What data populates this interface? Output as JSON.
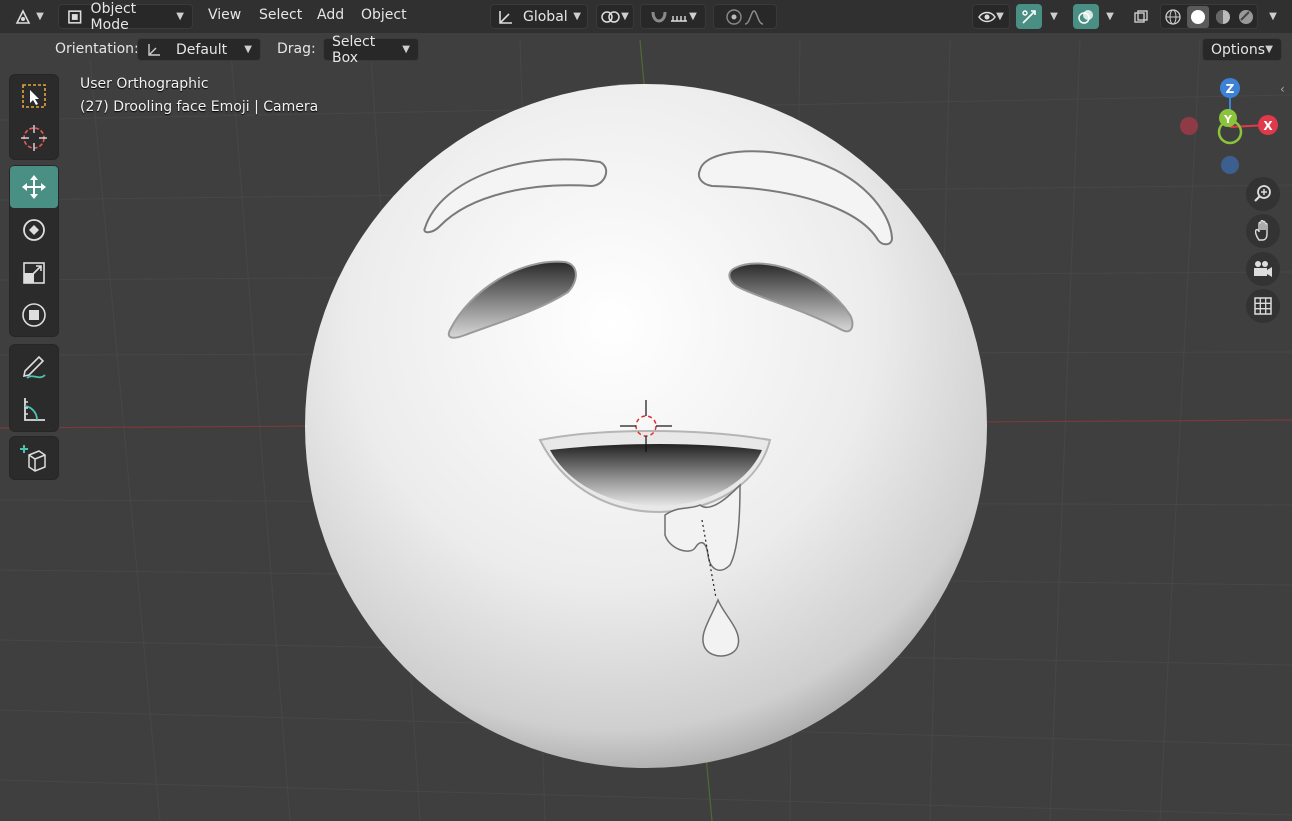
{
  "header": {
    "editor_type_icon": "editor-type-icon",
    "mode_label": "Object Mode",
    "menus": [
      "View",
      "Select",
      "Add",
      "Object"
    ],
    "transform_orientation": "Global",
    "shading_modes": [
      "wireframe",
      "solid",
      "material-preview",
      "rendered"
    ],
    "active_shading": "solid"
  },
  "toolsettings": {
    "orientation_label": "Orientation:",
    "orientation_value": "Default",
    "drag_label": "Drag:",
    "drag_value": "Select Box",
    "options_label": "Options"
  },
  "toolbar": {
    "tools": [
      "select-box",
      "cursor",
      "move",
      "rotate",
      "scale",
      "transform",
      "annotate",
      "measure",
      "add-cube"
    ],
    "active_tool": "move"
  },
  "viewport": {
    "view_name": "User Orthographic",
    "object_info": "(27) Drooling face Emoji | Camera"
  },
  "gizmo": {
    "x_label": "X",
    "y_label": "Y",
    "z_label": "Z",
    "x_color": "#e0394b",
    "y_color": "#8bc33b",
    "z_color": "#3c81d6"
  },
  "colors": {
    "accent": "#4a8f83",
    "header_bg": "#303030",
    "viewport_bg": "#3f3f3f"
  }
}
